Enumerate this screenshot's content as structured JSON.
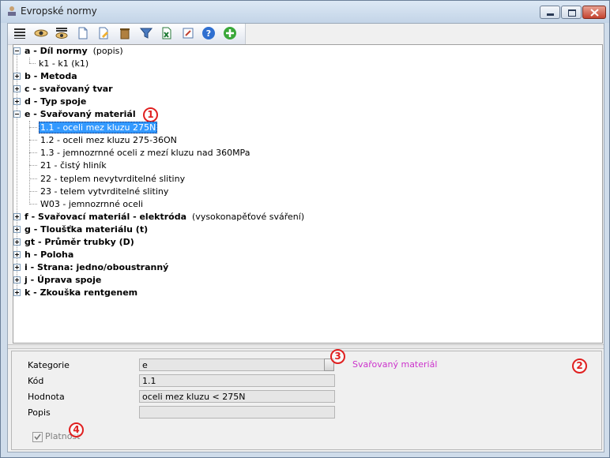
{
  "window": {
    "title": "Evropské normy"
  },
  "toolbar": {
    "buttons": [
      "list-icon",
      "eye-icon",
      "eye-list-icon",
      "new-document-icon",
      "edit-document-icon",
      "delete-icon",
      "filter-icon",
      "excel-icon",
      "edit-icon",
      "help-icon",
      "add-icon"
    ]
  },
  "tree": {
    "a": {
      "key": "a",
      "label": "Díl normy",
      "note": "(popis)",
      "child": "k1 - k1  (k1)"
    },
    "b": {
      "key": "b",
      "label": "Metoda"
    },
    "c": {
      "key": "c",
      "label": "svařovaný tvar"
    },
    "d": {
      "key": "d",
      "label": "Typ spoje"
    },
    "e": {
      "key": "e",
      "label": "Svařovaný materiál",
      "children": [
        "1.1 - oceli mez kluzu 275N",
        "1.2 - oceli mez kluzu 275-36ON",
        "1.3 - jemnozrnné oceli z mezí kluzu nad 360MPa",
        "21 - čistý hliník",
        "22 - teplem nevytvrditelné slitiny",
        "23 - telem vytvrditelné slitiny",
        "W03 - jemnozrnné oceli"
      ]
    },
    "f": {
      "key": "f",
      "label": "Svařovací materiál - elektróda",
      "note": "(vysokonapěťové sváření)"
    },
    "g": {
      "key": "g",
      "label": "Tloušťka materiálu (t)"
    },
    "gt": {
      "key": "gt",
      "label": "Průměr trubky (D)"
    },
    "h": {
      "key": "h",
      "label": "Poloha"
    },
    "i": {
      "key": "i",
      "label": "Strana: jedno/oboustranný"
    },
    "j": {
      "key": "j",
      "label": "Úprava spoje"
    },
    "k": {
      "key": "k",
      "label": "Zkouška rentgenem"
    }
  },
  "form": {
    "kategorie_label": "Kategorie",
    "kategorie_value": "e",
    "kategorie_desc": "Svařovaný materiál",
    "kod_label": "Kód",
    "kod_value": "1.1",
    "hodnota_label": "Hodnota",
    "hodnota_value": "oceli mez kluzu < 275N",
    "popis_label": "Popis",
    "popis_value": "",
    "platnost_label": "Platnost",
    "platnost_checked": true
  },
  "markers": [
    "1",
    "2",
    "3",
    "4"
  ],
  "colors": {
    "selection": "#3399ff",
    "accent": "#cc33cc",
    "marker": "#e02020"
  }
}
